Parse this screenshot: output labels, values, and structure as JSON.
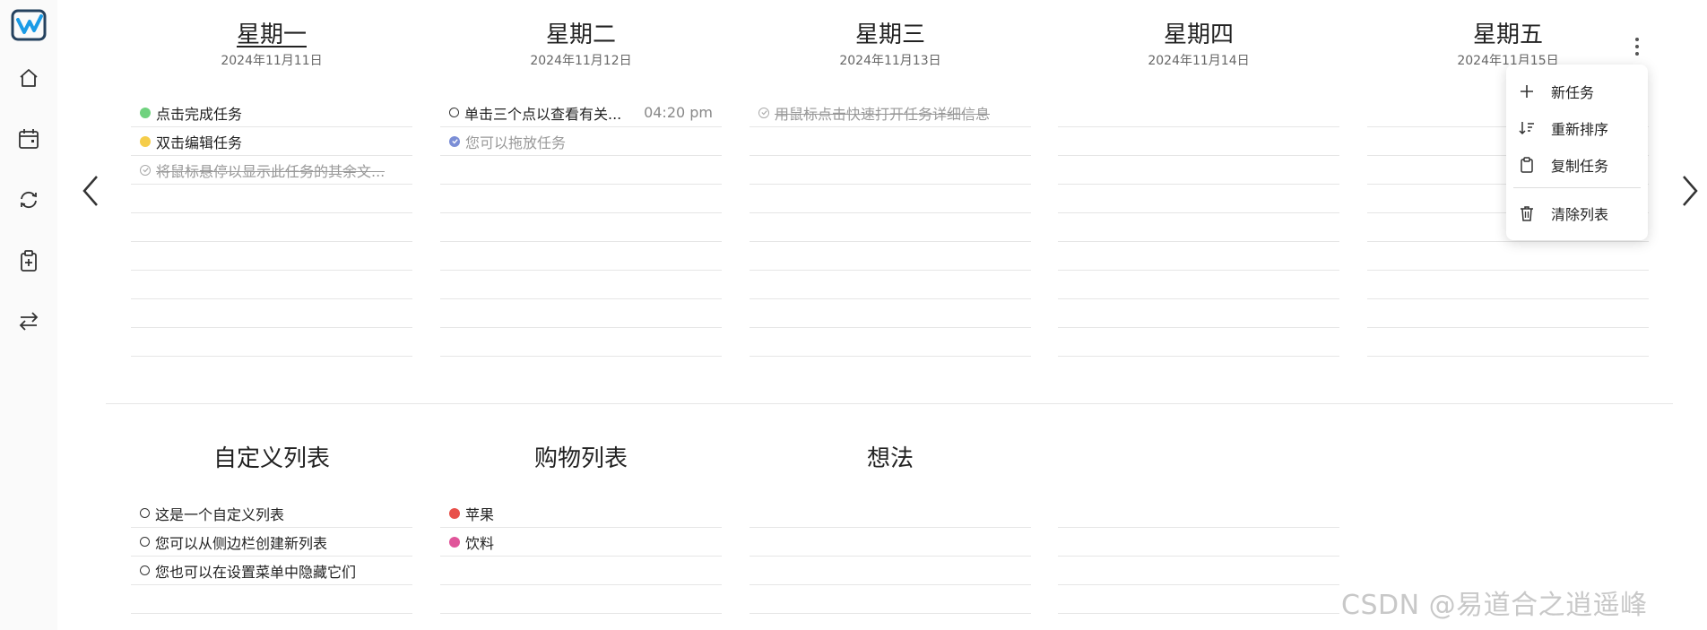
{
  "days": [
    {
      "name": "星期一",
      "date": "2024年11月11日",
      "today": true,
      "tasks": [
        {
          "text": "点击完成任务",
          "marker": "dot",
          "color": "#6fd27e"
        },
        {
          "text": "双击编辑任务",
          "marker": "dot",
          "color": "#f5cd4a"
        },
        {
          "text": "将鼠标悬停以显示此任务的其余文...",
          "marker": "done"
        }
      ]
    },
    {
      "name": "星期二",
      "date": "2024年11月12日",
      "today": false,
      "tasks": [
        {
          "text": "单击三个点以查看有关...",
          "marker": "ring",
          "time": "04:20 pm"
        },
        {
          "text": "您可以拖放任务",
          "marker": "blue-check"
        }
      ]
    },
    {
      "name": "星期三",
      "date": "2024年11月13日",
      "today": false,
      "tasks": [
        {
          "text": "用鼠标点击快速打开任务详细信息",
          "marker": "done"
        }
      ]
    },
    {
      "name": "星期四",
      "date": "2024年11月14日",
      "today": false,
      "tasks": []
    },
    {
      "name": "星期五",
      "date": "2024年11月15日",
      "today": false,
      "tasks": []
    }
  ],
  "lists": [
    {
      "title": "自定义列表",
      "tasks": [
        {
          "text": "这是一个自定义列表",
          "marker": "ring"
        },
        {
          "text": "您可以从侧边栏创建新列表",
          "marker": "ring"
        },
        {
          "text": "您也可以在设置菜单中隐藏它们",
          "marker": "ring"
        }
      ]
    },
    {
      "title": "购物列表",
      "tasks": [
        {
          "text": "苹果",
          "marker": "dot",
          "color": "#e8504a"
        },
        {
          "text": "饮料",
          "marker": "dot",
          "color": "#e0559a"
        }
      ]
    },
    {
      "title": "想法",
      "tasks": []
    }
  ],
  "menu": {
    "items": [
      {
        "label": "新任务",
        "icon": "plus-icon"
      },
      {
        "label": "重新排序",
        "icon": "sort-icon"
      },
      {
        "label": "复制任务",
        "icon": "clipboard-icon"
      },
      {
        "label": "清除列表",
        "icon": "trash-icon"
      }
    ]
  },
  "sidebar": {
    "icons": [
      "app-logo-icon",
      "home-icon",
      "calendar-icon",
      "sync-icon",
      "clipboard-add-icon",
      "swap-icon"
    ]
  },
  "watermark": "CSDN @易道合之逍遥峰",
  "colors": {
    "accent": "#1a9be6",
    "logo": "#24415e"
  }
}
